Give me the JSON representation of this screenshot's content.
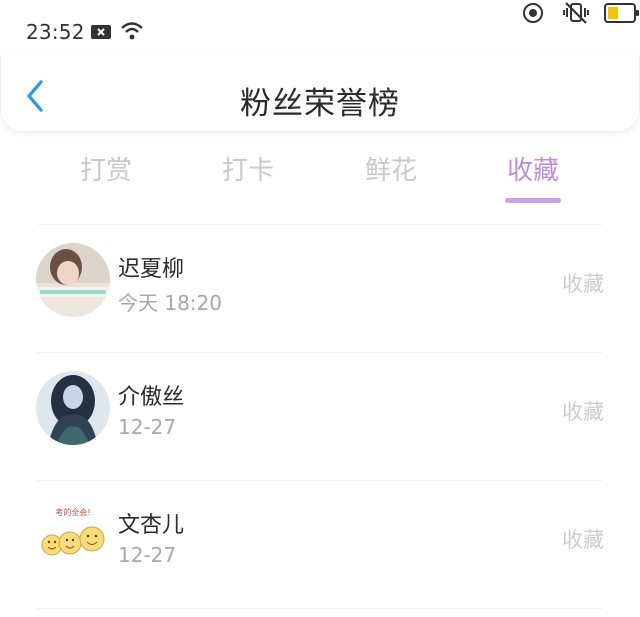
{
  "status_bar": {
    "time": "23:52",
    "icons": [
      "notification-icon",
      "wifi-icon",
      "target-icon",
      "vibrate-off-icon",
      "battery-icon"
    ],
    "battery_color": "#f5c400"
  },
  "header": {
    "title": "粉丝荣誉榜",
    "back_icon": "chevron-left-icon",
    "back_color": "#1e9be9"
  },
  "tabs": {
    "items": [
      {
        "label": "打赏",
        "active": false
      },
      {
        "label": "打卡",
        "active": false
      },
      {
        "label": "鲜花",
        "active": false
      },
      {
        "label": "收藏",
        "active": true
      }
    ],
    "active_color": "#b990d8",
    "inactive_color": "#c9c9c9"
  },
  "fans": [
    {
      "name": "迟夏柳",
      "time": "今天 18:20",
      "action": "收藏",
      "avatar": "girl-photo-avatar"
    },
    {
      "name": "介傲丝",
      "time": "12-27",
      "action": "收藏",
      "avatar": "anime-girl-avatar"
    },
    {
      "name": "文杏儿",
      "time": "12-27",
      "action": "收藏",
      "avatar": "emoji-faces-avatar",
      "avatar_caption": "考的全会!"
    }
  ]
}
